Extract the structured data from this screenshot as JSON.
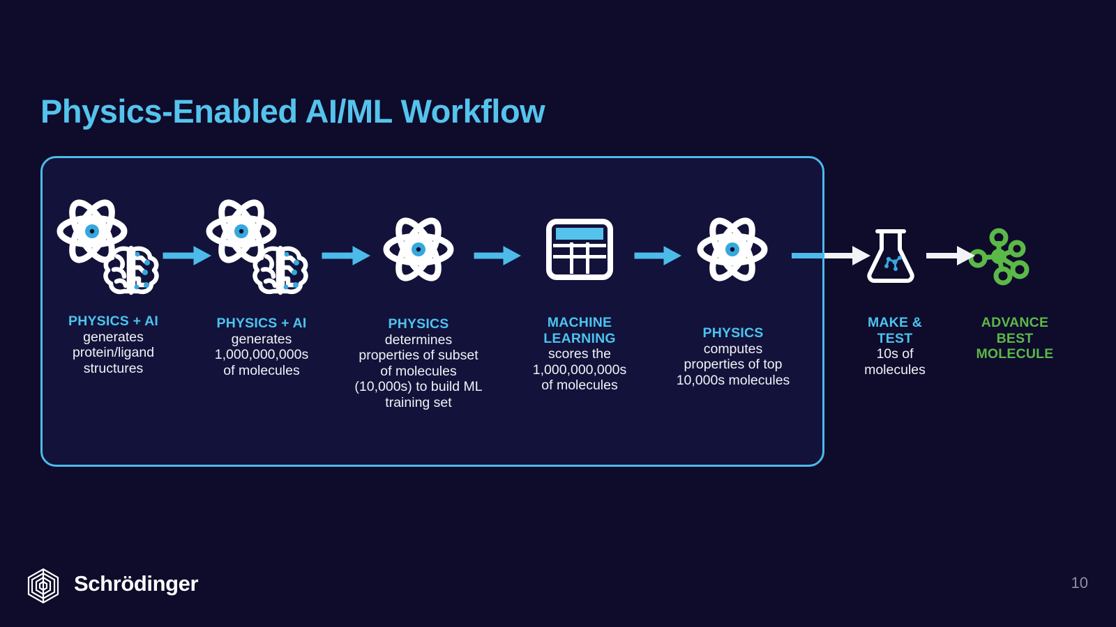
{
  "slide": {
    "title": "Physics-Enabled AI/ML Workflow",
    "page_number": "10",
    "background_color": "#0e0b2b",
    "accent_color": "#55c3ec",
    "panel_border_color": "#4cbbea",
    "panel_fill_color": "#12123a",
    "green_color": "#5bb947"
  },
  "logo": {
    "name": "Schrödinger",
    "mark": "hexagon-logo-icon"
  },
  "steps": [
    {
      "id": "step-1",
      "icon": "atom-brain-icon",
      "head": "PHYSICS + AI",
      "head_color": "#4cc3ef",
      "body": [
        "generates",
        "protein/ligand",
        "structures"
      ]
    },
    {
      "id": "step-2",
      "icon": "atom-brain-icon",
      "head": "PHYSICS + AI",
      "head_color": "#4cc3ef",
      "body": [
        "generates",
        "1,000,000,000s",
        "of molecules"
      ]
    },
    {
      "id": "step-3",
      "icon": "atom-icon",
      "head": "PHYSICS",
      "head_color": "#4cc3ef",
      "body": [
        "determines",
        "properties of subset",
        "of molecules",
        "(10,000s) to build ML",
        "training set"
      ]
    },
    {
      "id": "step-4",
      "icon": "spreadsheet-icon",
      "head": "MACHINE LEARNING",
      "head_color": "#4cc3ef",
      "body": [
        "scores the",
        "1,000,000,000s",
        "of molecules"
      ]
    },
    {
      "id": "step-5",
      "icon": "atom-icon",
      "head": "PHYSICS",
      "head_color": "#4cc3ef",
      "body": [
        "computes",
        "properties of top",
        "10,000s molecules"
      ]
    },
    {
      "id": "step-6",
      "icon": "flask-icon",
      "head": "MAKE & TEST",
      "head_color": "#4cc3ef",
      "body": [
        "10s of",
        "molecules"
      ]
    },
    {
      "id": "step-7",
      "icon": "molecule-icon",
      "head": "ADVANCE BEST MOLECULE",
      "head_color": "#5bb947",
      "body": []
    }
  ],
  "arrows": [
    {
      "id": "arrow-1",
      "color": "#4cbbea"
    },
    {
      "id": "arrow-2",
      "color": "#4cbbea"
    },
    {
      "id": "arrow-3",
      "color": "#4cbbea"
    },
    {
      "id": "arrow-4",
      "color": "#4cbbea"
    },
    {
      "id": "arrow-5",
      "color": "#4cbbea"
    },
    {
      "id": "arrow-6",
      "color": "#ffffff"
    }
  ]
}
